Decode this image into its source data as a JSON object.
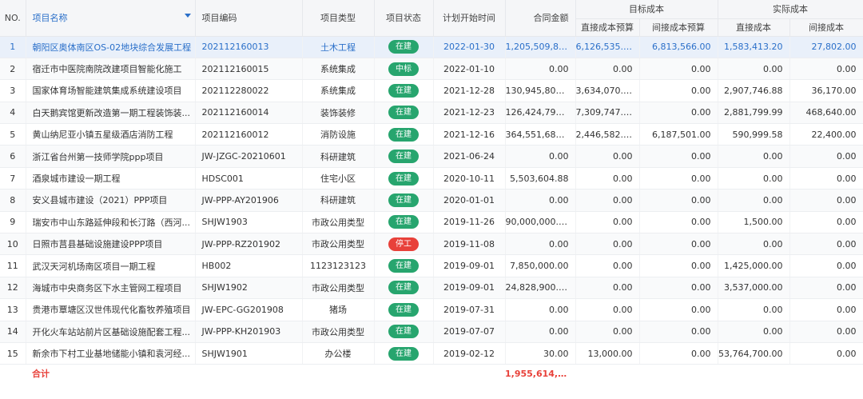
{
  "headers": {
    "no": "NO.",
    "name": "项目名称",
    "code": "项目编码",
    "type": "项目类型",
    "status": "项目状态",
    "start": "计划开始时间",
    "amount": "合同金额",
    "target_group": "目标成本",
    "actual_group": "实际成本",
    "target_direct": "直接成本预算",
    "target_indirect": "间接成本预算",
    "actual_direct": "直接成本",
    "actual_indirect": "间接成本"
  },
  "colors": {
    "accent": "#2a6fc9",
    "status_active": "#27a56e",
    "status_stopped": "#e8413a",
    "total": "#e8413a"
  },
  "rows": [
    {
      "no": "1",
      "name": "朝阳区奥体南区OS-02地块综合发展工程",
      "code": "202112160013",
      "type": "土木工程",
      "status": "在建",
      "start": "2022-01-30",
      "amount": "1,205,509,82...",
      "target_direct": "6,126,535.50",
      "target_indirect": "6,813,566.00",
      "actual_direct": "1,583,413.20",
      "actual_indirect": "27,802.00"
    },
    {
      "no": "2",
      "name": "宿迁市中医院南院改建项目智能化施工",
      "code": "202112160015",
      "type": "系统集成",
      "status": "中标",
      "start": "2022-01-10",
      "amount": "0.00",
      "target_direct": "0.00",
      "target_indirect": "0.00",
      "actual_direct": "0.00",
      "actual_indirect": "0.00"
    },
    {
      "no": "3",
      "name": "国家体育场智能建筑集成系统建设项目",
      "code": "202112280022",
      "type": "系统集成",
      "status": "在建",
      "start": "2021-12-28",
      "amount": "130,945,800.00",
      "target_direct": "3,634,070.08",
      "target_indirect": "0.00",
      "actual_direct": "2,907,746.88",
      "actual_indirect": "36,170.00"
    },
    {
      "no": "4",
      "name": "白天鹅宾馆更新改造第一期工程装饰装...",
      "code": "202112160014",
      "type": "装饰装修",
      "status": "在建",
      "start": "2021-12-23",
      "amount": "126,424,799.35",
      "target_direct": "7,309,747.64",
      "target_indirect": "0.00",
      "actual_direct": "2,881,799.99",
      "actual_indirect": "468,640.00"
    },
    {
      "no": "5",
      "name": "黄山纳尼亚小镇五星级酒店消防工程",
      "code": "202112160012",
      "type": "消防设施",
      "status": "在建",
      "start": "2021-12-16",
      "amount": "364,551,686.34",
      "target_direct": "2,446,582.37",
      "target_indirect": "6,187,501.00",
      "actual_direct": "590,999.58",
      "actual_indirect": "22,400.00"
    },
    {
      "no": "6",
      "name": "浙江省台州第一技师学院ppp项目",
      "code": "JW-JZGC-20210601",
      "type": "科研建筑",
      "status": "在建",
      "start": "2021-06-24",
      "amount": "0.00",
      "target_direct": "0.00",
      "target_indirect": "0.00",
      "actual_direct": "0.00",
      "actual_indirect": "0.00"
    },
    {
      "no": "7",
      "name": "酒泉城市建设一期工程",
      "code": "HDSC001",
      "type": "住宅小区",
      "status": "在建",
      "start": "2020-10-11",
      "amount": "5,503,604.88",
      "target_direct": "0.00",
      "target_indirect": "0.00",
      "actual_direct": "0.00",
      "actual_indirect": "0.00"
    },
    {
      "no": "8",
      "name": "安义县城市建设（2021）PPP项目",
      "code": "JW-PPP-AY201906",
      "type": "科研建筑",
      "status": "在建",
      "start": "2020-01-01",
      "amount": "0.00",
      "target_direct": "0.00",
      "target_indirect": "0.00",
      "actual_direct": "0.00",
      "actual_indirect": "0.00"
    },
    {
      "no": "9",
      "name": "瑞安市中山东路延伸段和长汀路（西河...",
      "code": "SHJW1903",
      "type": "市政公用类型",
      "status": "在建",
      "start": "2019-11-26",
      "amount": "90,000,000.00",
      "target_direct": "0.00",
      "target_indirect": "0.00",
      "actual_direct": "1,500.00",
      "actual_indirect": "0.00"
    },
    {
      "no": "10",
      "name": "日照市莒县基础设施建设PPP项目",
      "code": "JW-PPP-RZ201902",
      "type": "市政公用类型",
      "status": "停工",
      "start": "2019-11-08",
      "amount": "0.00",
      "target_direct": "0.00",
      "target_indirect": "0.00",
      "actual_direct": "0.00",
      "actual_indirect": "0.00"
    },
    {
      "no": "11",
      "name": "武汉天河机场南区项目一期工程",
      "code": "HB002",
      "type": "1123123123",
      "status": "在建",
      "start": "2019-09-01",
      "amount": "7,850,000.00",
      "target_direct": "0.00",
      "target_indirect": "0.00",
      "actual_direct": "1,425,000.00",
      "actual_indirect": "0.00"
    },
    {
      "no": "12",
      "name": "海城市中央商务区下水主管网工程项目",
      "code": "SHJW1902",
      "type": "市政公用类型",
      "status": "在建",
      "start": "2019-09-01",
      "amount": "24,828,900.00",
      "target_direct": "0.00",
      "target_indirect": "0.00",
      "actual_direct": "3,537,000.00",
      "actual_indirect": "0.00"
    },
    {
      "no": "13",
      "name": "贵港市覃塘区汉世伟现代化畜牧养殖项目",
      "code": "JW-EPC-GG201908",
      "type": "猪场",
      "status": "在建",
      "start": "2019-07-31",
      "amount": "0.00",
      "target_direct": "0.00",
      "target_indirect": "0.00",
      "actual_direct": "0.00",
      "actual_indirect": "0.00"
    },
    {
      "no": "14",
      "name": "开化火车站站前片区基础设施配套工程...",
      "code": "JW-PPP-KH201903",
      "type": "市政公用类型",
      "status": "在建",
      "start": "2019-07-07",
      "amount": "0.00",
      "target_direct": "0.00",
      "target_indirect": "0.00",
      "actual_direct": "0.00",
      "actual_indirect": "0.00"
    },
    {
      "no": "15",
      "name": "新余市下村工业基地储能小镇和袁河经...",
      "code": "SHJW1901",
      "type": "办公楼",
      "status": "在建",
      "start": "2019-02-12",
      "amount": "30.00",
      "target_direct": "13,000.00",
      "target_indirect": "0.00",
      "actual_direct": "53,764,700.00",
      "actual_indirect": "0.00"
    }
  ],
  "total": {
    "label": "合计",
    "amount": "1,955,614,64..."
  }
}
